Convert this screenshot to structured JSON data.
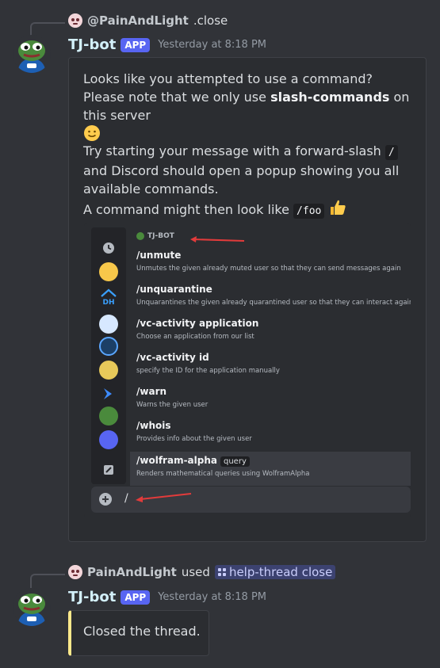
{
  "msg1": {
    "reply_user": "@PainAndLight",
    "reply_command": ".close",
    "bot_name": "TJ-bot",
    "badge": "APP",
    "timestamp": "Yesterday at 8:18 PM",
    "para1_a": "Looks like you attempted to use a command? Please note that we only use ",
    "para1_bold": "slash-commands",
    "para1_b": " on this server",
    "para2_a": "Try starting your message with a forward-slash ",
    "para2_code": "/",
    "para2_b": " and Discord should open a popup showing you all available commands.",
    "para3_a": "A command might then look like ",
    "para3_code": "/foo",
    "screenshot": {
      "header": "TJ-BOT",
      "chat_input": "/",
      "commands": [
        {
          "name": "/unmute",
          "desc": "Unmutes the given already muted user so that they can send messages again"
        },
        {
          "name": "/unquarantine",
          "desc": "Unquarantines the given already quarantined user so that they can interact again"
        },
        {
          "name": "/vc-activity application",
          "desc": "Choose an application from our list"
        },
        {
          "name": "/vc-activity id",
          "desc": "specify the ID for the application manually"
        },
        {
          "name": "/warn",
          "desc": "Warns the given user"
        },
        {
          "name": "/whois",
          "desc": "Provides info about the given user"
        },
        {
          "name": "/wolfram-alpha",
          "option": "query",
          "desc": "Renders mathematical queries using WolframAlpha"
        }
      ]
    }
  },
  "msg2": {
    "user": "PainAndLight",
    "used": "used",
    "command": "help-thread close",
    "bot_name": "TJ-bot",
    "badge": "APP",
    "timestamp": "Yesterday at 8:18 PM",
    "embed_text": "Closed the thread."
  },
  "colors": {
    "background": "#313338",
    "embed_bg": "#2b2d31",
    "app_badge": "#5865f2",
    "closed_accent": "#fce98b",
    "arrow": "#e23b3b"
  }
}
